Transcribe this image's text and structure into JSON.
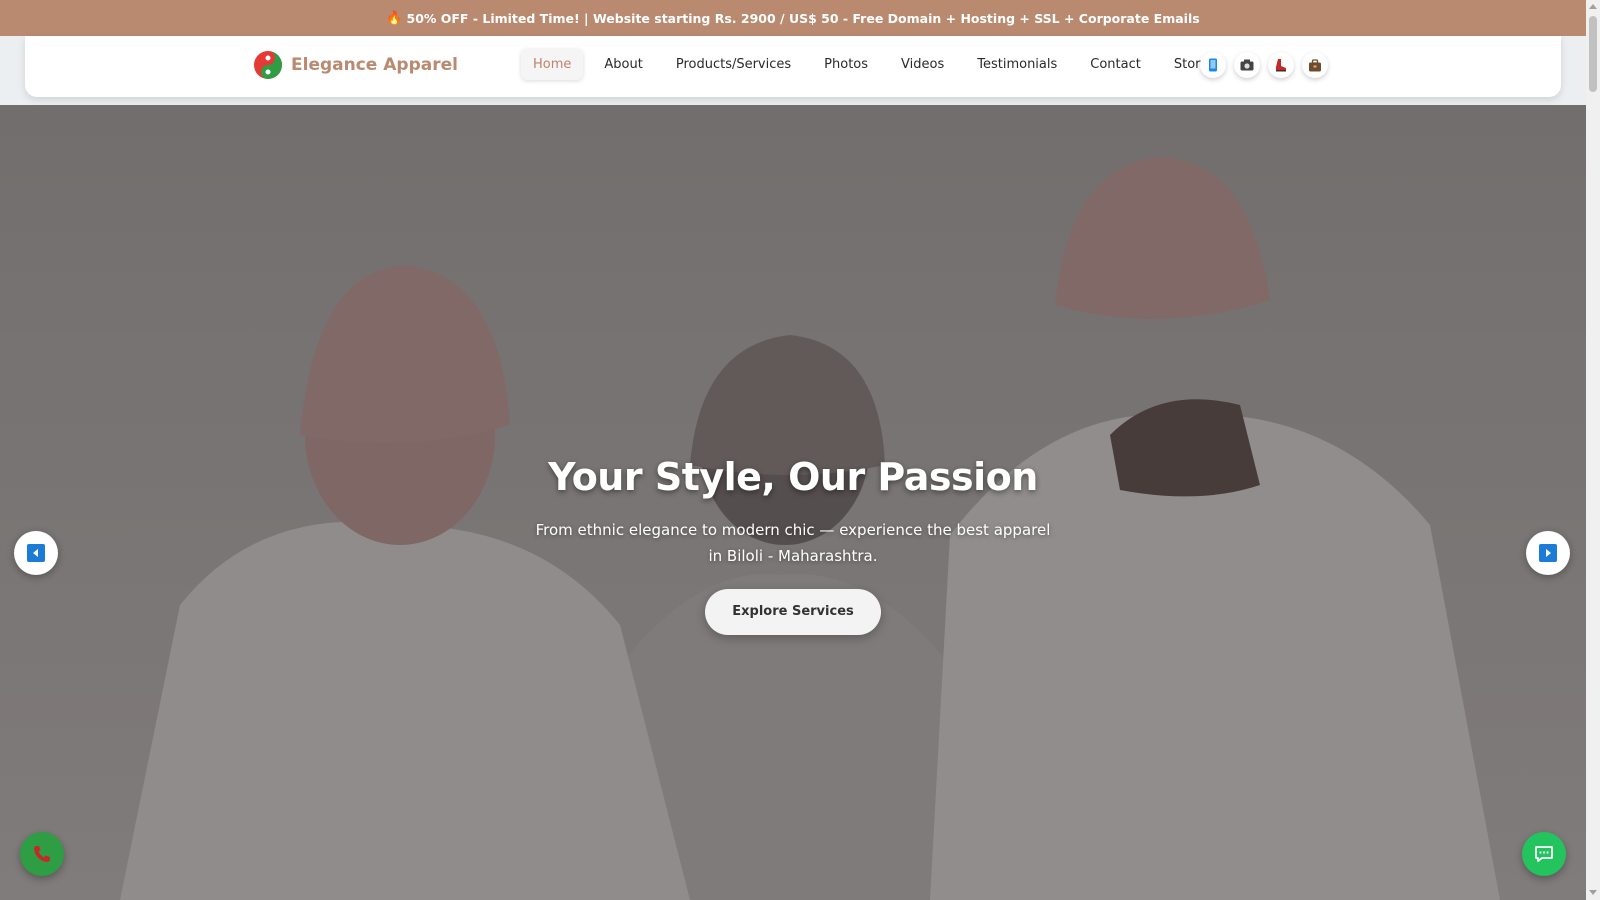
{
  "promo": {
    "icon": "fire-icon",
    "text": "50% OFF - Limited Time! | Website starting Rs. 2900 / US$ 50 - Free Domain + Hosting + SSL + Corporate Emails"
  },
  "brand": {
    "name": "Elegance Apparel",
    "color": "#b98a6f"
  },
  "nav": {
    "items": [
      {
        "label": "Home",
        "active": true
      },
      {
        "label": "About"
      },
      {
        "label": "Products/Services"
      },
      {
        "label": "Photos"
      },
      {
        "label": "Videos"
      },
      {
        "label": "Testimonials"
      },
      {
        "label": "Contact"
      },
      {
        "label": "Store"
      }
    ],
    "icons": [
      "mobile-icon",
      "camera-icon",
      "shoe-icon",
      "bag-icon"
    ]
  },
  "hero": {
    "title": "Your Style, Our Passion",
    "subtitle": "From ethnic elegance to modern chic — experience the best apparel in Biloli - Maharashtra.",
    "button": "Explore Services"
  },
  "colors": {
    "promo_bg": "#b98a6f",
    "active_nav": "#c0826b",
    "arrow_blue": "#1d7bd8",
    "call_green": "#2e9d44",
    "chat_green": "#23c35d"
  }
}
